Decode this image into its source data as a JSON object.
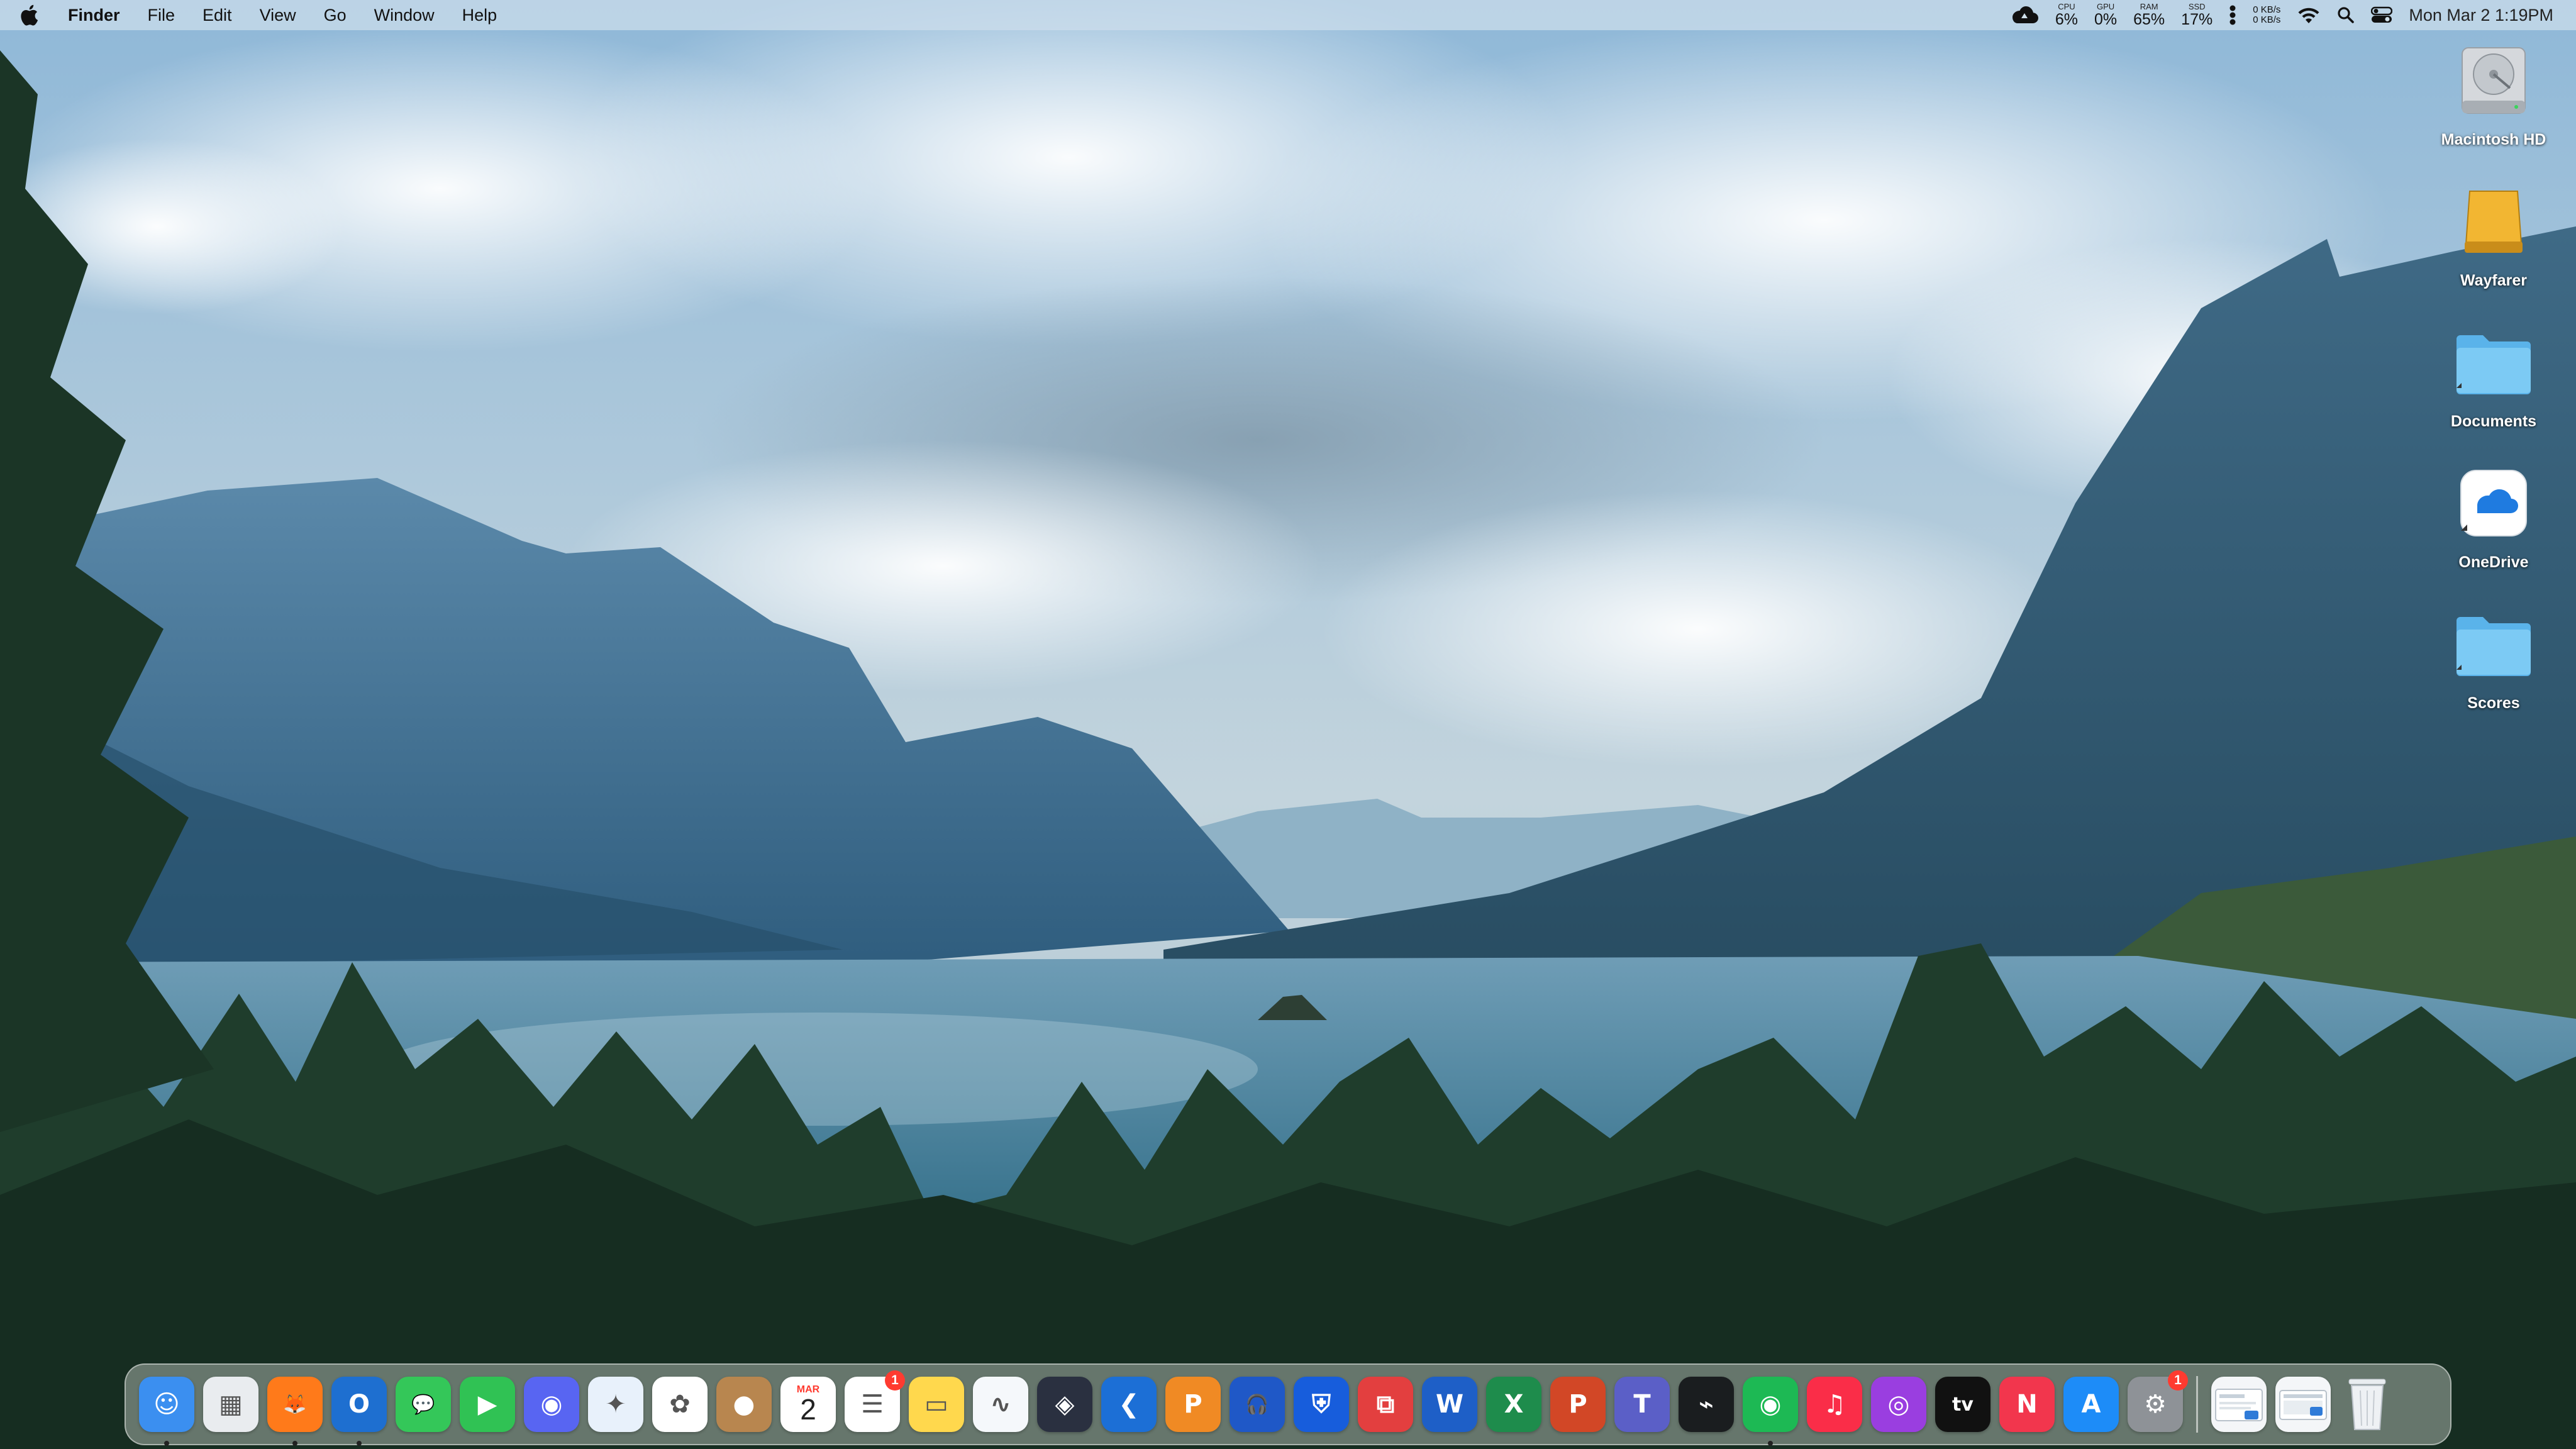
{
  "menubar": {
    "app_name": "Finder",
    "menus": [
      "File",
      "Edit",
      "View",
      "Go",
      "Window",
      "Help"
    ],
    "stats": [
      {
        "label": "CPU",
        "value": "6%"
      },
      {
        "label": "GPU",
        "value": "0%"
      },
      {
        "label": "RAM",
        "value": "65%"
      },
      {
        "label": "SSD",
        "value": "17%"
      }
    ],
    "network": {
      "up": "0 KB/s",
      "down": "0 KB/s"
    },
    "datetime": "Mon Mar 2  1:19PM",
    "icons": [
      "apple-icon",
      "cloud-status-icon",
      "more-icon",
      "wifi-icon",
      "search-icon",
      "control-center-icon"
    ]
  },
  "desktop": {
    "icons": [
      {
        "name": "Macintosh HD",
        "icon": "hard-drive-icon"
      },
      {
        "name": "Wayfarer",
        "icon": "external-drive-icon"
      },
      {
        "name": "Documents",
        "icon": "folder-icon"
      },
      {
        "name": "OneDrive",
        "icon": "onedrive-icon"
      },
      {
        "name": "Scores",
        "icon": "folder-icon"
      }
    ]
  },
  "dock": {
    "calendar": {
      "month": "MAR",
      "day": "2"
    },
    "badges": {
      "reminders": "1",
      "system_settings": "1"
    },
    "apps": [
      {
        "id": "finder",
        "icon": "finder-icon",
        "glyph": "☺",
        "color": "#3b8ff0",
        "running": true
      },
      {
        "id": "launchpad",
        "icon": "launchpad-icon",
        "glyph": "▦",
        "color": "#e9ecef",
        "running": false
      },
      {
        "id": "firefox",
        "icon": "firefox-icon",
        "glyph": "🦊",
        "color": "#ff7a1a",
        "running": true
      },
      {
        "id": "outlook",
        "icon": "outlook-icon",
        "glyph": "O",
        "color": "#1e6fd0",
        "running": true
      },
      {
        "id": "messages",
        "icon": "messages-icon",
        "glyph": "💬",
        "color": "#34c759",
        "running": false
      },
      {
        "id": "facetime",
        "icon": "facetime-icon",
        "glyph": "▶",
        "color": "#30c254",
        "running": false
      },
      {
        "id": "discord",
        "icon": "discord-icon",
        "glyph": "◉",
        "color": "#5865f2",
        "running": false
      },
      {
        "id": "safari",
        "icon": "safari-icon",
        "glyph": "✦",
        "color": "#e8f1fb",
        "running": false
      },
      {
        "id": "photos",
        "icon": "photos-icon",
        "glyph": "✿",
        "color": "#ffffff",
        "running": false
      },
      {
        "id": "contacts",
        "icon": "contacts-icon",
        "glyph": "●",
        "color": "#b8864f",
        "running": false
      },
      {
        "id": "calendar",
        "icon": "calendar-icon",
        "glyph": "",
        "color": "#ffffff",
        "running": false
      },
      {
        "id": "reminders",
        "icon": "reminders-icon",
        "glyph": "☰",
        "color": "#ffffff",
        "running": false
      },
      {
        "id": "notes",
        "icon": "notes-icon",
        "glyph": "▭",
        "color": "#ffd84d",
        "running": false
      },
      {
        "id": "freeform",
        "icon": "freeform-icon",
        "glyph": "∿",
        "color": "#f5f8fb",
        "running": false
      },
      {
        "id": "davinci",
        "icon": "davinci-resolve-icon",
        "glyph": "◈",
        "color": "#2a3040",
        "running": false
      },
      {
        "id": "xcode-cli",
        "icon": "visual-studio-code-icon",
        "glyph": "❮",
        "color": "#1c6fd6",
        "running": false
      },
      {
        "id": "pdf",
        "icon": "pdf-expert-icon",
        "glyph": "P",
        "color": "#f08a24",
        "running": false
      },
      {
        "id": "audacity",
        "icon": "audacity-icon",
        "glyph": "🎧",
        "color": "#1f58c7",
        "running": false
      },
      {
        "id": "bitwarden",
        "icon": "bitwarden-icon",
        "glyph": "⛨",
        "color": "#175ddc",
        "running": false
      },
      {
        "id": "remote",
        "icon": "remote-desktop-icon",
        "glyph": "⧉",
        "color": "#e33f3f",
        "running": false
      },
      {
        "id": "word",
        "icon": "word-icon",
        "glyph": "W",
        "color": "#1e5fc7",
        "running": false
      },
      {
        "id": "excel",
        "icon": "excel-icon",
        "glyph": "X",
        "color": "#1e8c4c",
        "running": false
      },
      {
        "id": "powerpoint",
        "icon": "powerpoint-icon",
        "glyph": "P",
        "color": "#d24726",
        "running": false
      },
      {
        "id": "teams",
        "icon": "teams-icon",
        "glyph": "T",
        "color": "#5b5fc7",
        "running": false
      },
      {
        "id": "activity",
        "icon": "activity-monitor-icon",
        "glyph": "⌁",
        "color": "#1a1d1f",
        "running": false
      },
      {
        "id": "spotify",
        "icon": "spotify-icon",
        "glyph": "◉",
        "color": "#1db954",
        "running": true
      },
      {
        "id": "music",
        "icon": "music-icon",
        "glyph": "♫",
        "color": "#fa2d48",
        "running": false
      },
      {
        "id": "podcasts",
        "icon": "podcasts-icon",
        "glyph": "◎",
        "color": "#9a3ee0",
        "running": false
      },
      {
        "id": "tv",
        "icon": "apple-tv-icon",
        "glyph": "tv",
        "color": "#111111",
        "running": false
      },
      {
        "id": "news",
        "icon": "news-icon",
        "glyph": "N",
        "color": "#f2364d",
        "running": false
      },
      {
        "id": "appstore",
        "icon": "app-store-icon",
        "glyph": "A",
        "color": "#1d8cf8",
        "running": false
      },
      {
        "id": "settings",
        "icon": "system-settings-icon",
        "glyph": "⚙",
        "color": "#8e9297",
        "running": false
      }
    ],
    "extras": [
      {
        "id": "downloads-stack",
        "icon": "downloads-stack-icon"
      },
      {
        "id": "documents-stack",
        "icon": "screenshots-stack-icon"
      },
      {
        "id": "trash",
        "icon": "trash-icon"
      }
    ]
  }
}
